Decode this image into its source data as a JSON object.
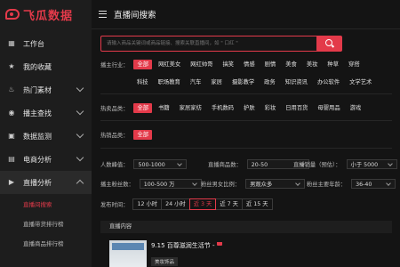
{
  "brand": {
    "name": "飞瓜数据",
    "color": "#e33a4a"
  },
  "sidebar": {
    "items": [
      {
        "label": "工作台",
        "icon": "dashboard-icon"
      },
      {
        "label": "我的收藏",
        "icon": "star-icon"
      },
      {
        "label": "热门素材",
        "icon": "fire-icon",
        "expandable": true
      },
      {
        "label": "播主查找",
        "icon": "user-icon",
        "expandable": true
      },
      {
        "label": "数据监测",
        "icon": "monitor-icon",
        "expandable": true
      },
      {
        "label": "电商分析",
        "icon": "cart-icon",
        "expandable": true
      },
      {
        "label": "直播分析",
        "icon": "live-icon",
        "expandable": true,
        "open": true
      }
    ],
    "sub_items": [
      {
        "label": "直播间搜索",
        "active": true
      },
      {
        "label": "直播带货排行榜",
        "active": false
      },
      {
        "label": "直播商品排行榜",
        "active": false
      }
    ]
  },
  "header": {
    "title": "直播间搜索"
  },
  "search": {
    "placeholder": "请输入商品关键词或商品链接、搜索关联直播间，如 \" 口红 \""
  },
  "filters": {
    "industry_label": "播主行业：",
    "industry_row1": [
      "全部",
      "网红美女",
      "网红帅哥",
      "搞笑",
      "情感",
      "剧情",
      "美食",
      "美妆",
      "种草",
      "穿搭"
    ],
    "industry_row2": [
      "科技",
      "职场教育",
      "汽车",
      "家居",
      "摄影教学",
      "政务",
      "知识资讯",
      "办公软件",
      "文学艺术"
    ],
    "hot_label1": "热卖品类：",
    "hot_row1": [
      "全部",
      "书籍",
      "家居家纺",
      "手机数码",
      "护肤",
      "彩妆",
      "日用百货",
      "母婴用品",
      "游戏"
    ],
    "hot_label2": "热销品类：",
    "hot_row2": [
      "全部"
    ]
  },
  "dropdowns": {
    "viewers_label": "人数峰值：",
    "viewers_value": "500-1000",
    "products_label": "直播商品数：",
    "products_value": "20-50",
    "sales_label": "直播销量（预估）：",
    "sales_value": "小于 5000",
    "fans_label": "播主粉丝数：",
    "fans_value": "100-500 万",
    "gender_label": "粉丝男女比例：",
    "gender_value": "男观众多",
    "age_label": "粉丝主要年龄：",
    "age_value": "36-40"
  },
  "time": {
    "label": "发布时间：",
    "options": [
      "12 小时",
      "24 小时",
      "近 3 天",
      "近 7 天",
      "近 15 天"
    ],
    "selected": "近 3 天"
  },
  "list": {
    "header": "直播内容",
    "item_title": "9.15 百尊滋润生活节 -",
    "item_tag": "美妆饰品"
  }
}
